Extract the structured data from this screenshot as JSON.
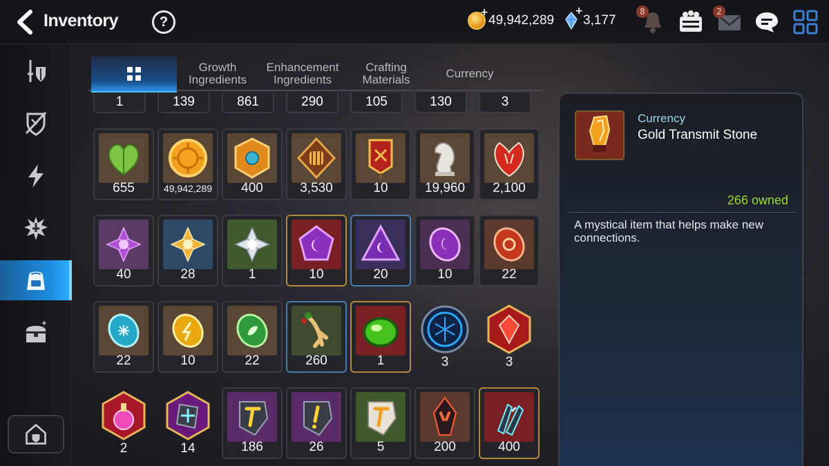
{
  "header": {
    "title": "Inventory",
    "help_label": "?",
    "gold": "49,942,289",
    "crystals": "3,177",
    "notification_badge": "8",
    "mail_badge": "2"
  },
  "sidebar": {
    "items": [
      {
        "icon": "sword-shield-icon",
        "active": false
      },
      {
        "icon": "broken-shield-icon",
        "active": false
      },
      {
        "icon": "lightning-icon",
        "active": false
      },
      {
        "icon": "splash-badge-icon",
        "active": false
      },
      {
        "icon": "backpack-icon",
        "active": true
      },
      {
        "icon": "treasure-chest-icon",
        "active": false
      }
    ],
    "bottom_icon": "house-shield-icon"
  },
  "tabs": [
    {
      "label": "",
      "icon": "grid-icon",
      "active": true
    },
    {
      "label": "Growth\nIngredients",
      "active": false
    },
    {
      "label": "Enhancement\nIngredients",
      "active": false
    },
    {
      "label": "Crafting\nMaterials",
      "active": false
    },
    {
      "label": "Currency",
      "active": false
    }
  ],
  "partial_row": [
    "1",
    "139",
    "861",
    "290",
    "105",
    "130",
    "3"
  ],
  "rows": [
    [
      "655",
      "49,942,289",
      "400",
      "3,530",
      "10",
      "19,960",
      "2,100"
    ],
    [
      "40",
      "28",
      "1",
      "10",
      "20",
      "10",
      "22"
    ],
    [
      "22",
      "10",
      "22",
      "260",
      "1",
      "3",
      "3"
    ],
    [
      "2",
      "14",
      "186",
      "26",
      "5",
      "200",
      "400"
    ]
  ],
  "detail": {
    "category": "Currency",
    "name": "Gold Transmit Stone",
    "owned": "266 owned",
    "description": "A mystical item that helps make new connections."
  },
  "colors": {
    "accent_blue": "#1c8de0",
    "owned_green": "#9bdc2c",
    "category_blue": "#9fd6f0"
  }
}
